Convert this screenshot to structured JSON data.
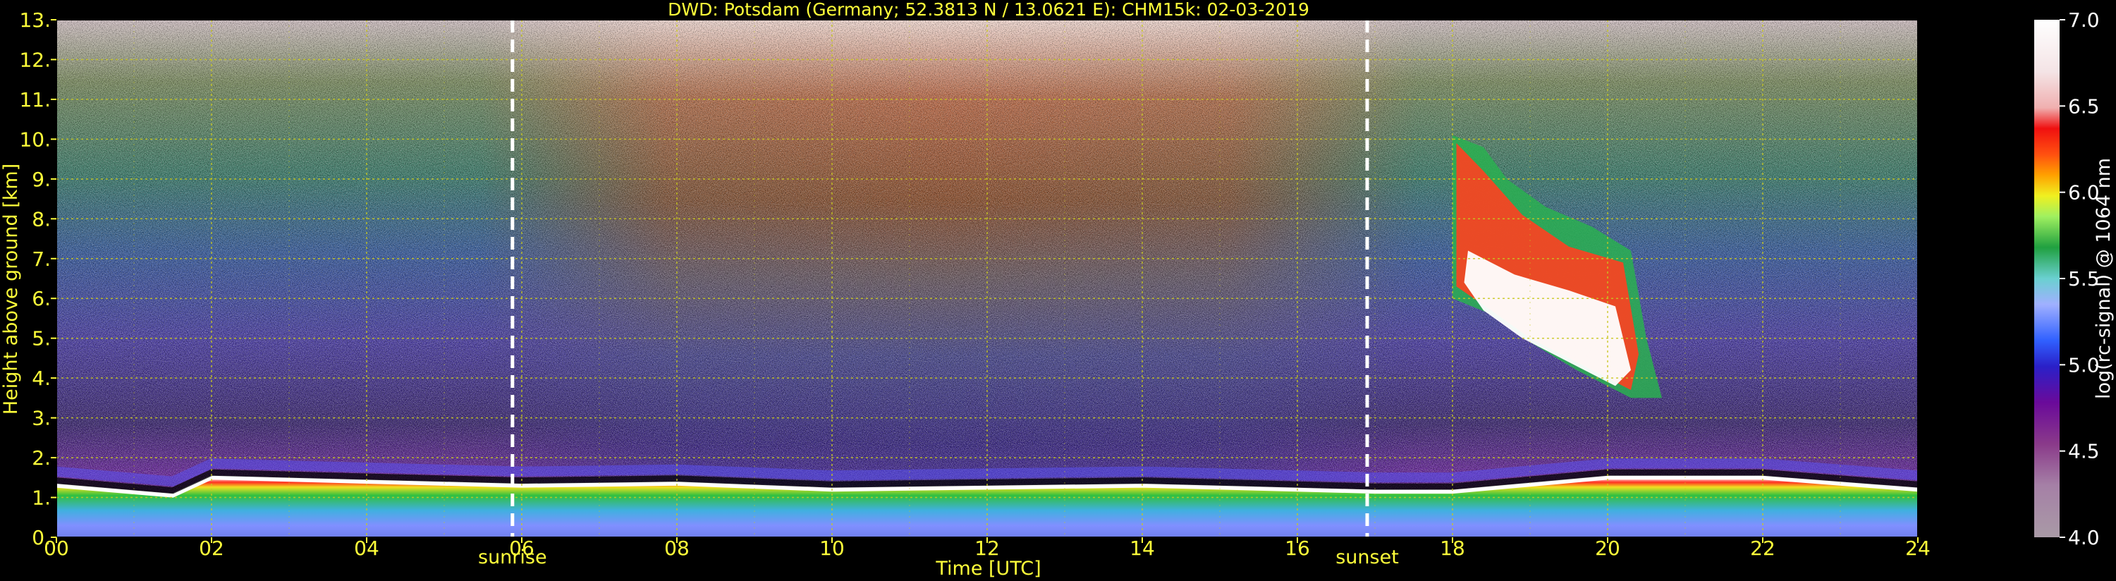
{
  "chart_data": {
    "type": "heatmap",
    "title": "DWD: Potsdam (Germany; 52.3813 N / 13.0621 E):    CHM15k: 02-03-2019",
    "xlabel": "Time [UTC]",
    "ylabel": "Height above ground [km]",
    "xlim": [
      0,
      24
    ],
    "ylim": [
      0,
      13
    ],
    "x_ticks": [
      "00",
      "02",
      "04",
      "06",
      "08",
      "10",
      "12",
      "14",
      "16",
      "18",
      "20",
      "22",
      "24"
    ],
    "y_ticks": [
      "0.",
      "1.",
      "2.",
      "3.",
      "4.",
      "5.",
      "6.",
      "7.",
      "8.",
      "9.",
      "10.",
      "11.",
      "12.",
      "13."
    ],
    "grid": true,
    "markers": [
      {
        "label": "sunrise",
        "x": 5.88
      },
      {
        "label": "sunset",
        "x": 16.9
      }
    ],
    "colorbar": {
      "label": "log(rc-signal) @ 1064 nm",
      "range": [
        4.0,
        7.0
      ],
      "ticks": [
        "4.0",
        "4.5",
        "5.0",
        "5.5",
        "6.0",
        "6.5",
        "7.0"
      ]
    },
    "features": {
      "boundary_layer_top_km": [
        [
          0,
          1.3
        ],
        [
          1.5,
          1.05
        ],
        [
          2,
          1.5
        ],
        [
          4,
          1.4
        ],
        [
          6,
          1.3
        ],
        [
          8,
          1.35
        ],
        [
          10,
          1.2
        ],
        [
          12,
          1.25
        ],
        [
          14,
          1.3
        ],
        [
          16,
          1.2
        ],
        [
          17,
          1.15
        ],
        [
          18,
          1.15
        ],
        [
          20,
          1.5
        ],
        [
          22,
          1.5
        ],
        [
          24,
          1.2
        ]
      ],
      "cirrus_cloud": {
        "time_start": 18.0,
        "time_end": 20.7,
        "top_km": [
          10.1,
          3.5
        ],
        "base_km": [
          6.0,
          3.5
        ]
      }
    }
  },
  "colors": {
    "annotation": "#ffff3a",
    "grid": "#c8c820",
    "background": "#000000",
    "marker_line": "#ffffff"
  }
}
